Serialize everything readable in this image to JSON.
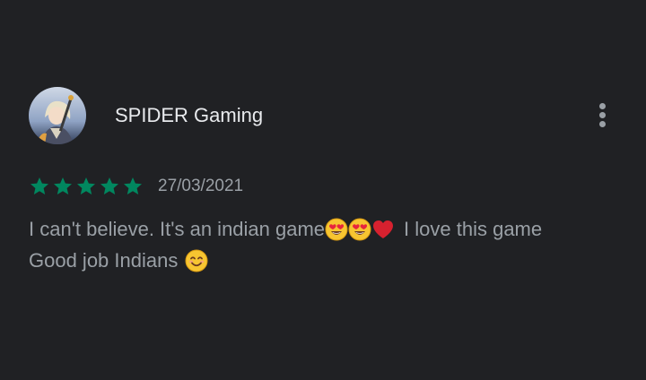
{
  "review": {
    "author": "SPIDER Gaming",
    "rating": 5,
    "rating_max": 5,
    "date": "27/03/2021",
    "text_line1_part1": "I can't believe. It's an indian game",
    "text_line1_part2": "I love this game",
    "text_line2": "Good job Indians",
    "emojis": [
      "heart-eyes-emoji",
      "heart-eyes-emoji",
      "red-heart-emoji",
      "smiling-face-emoji"
    ]
  },
  "colors": {
    "background": "#202124",
    "author_text": "#e8eaed",
    "secondary_text": "#9aa0a6",
    "star": "#01875f"
  },
  "icons": {
    "menu": "more-vertical-icon",
    "avatar": "user-avatar"
  }
}
